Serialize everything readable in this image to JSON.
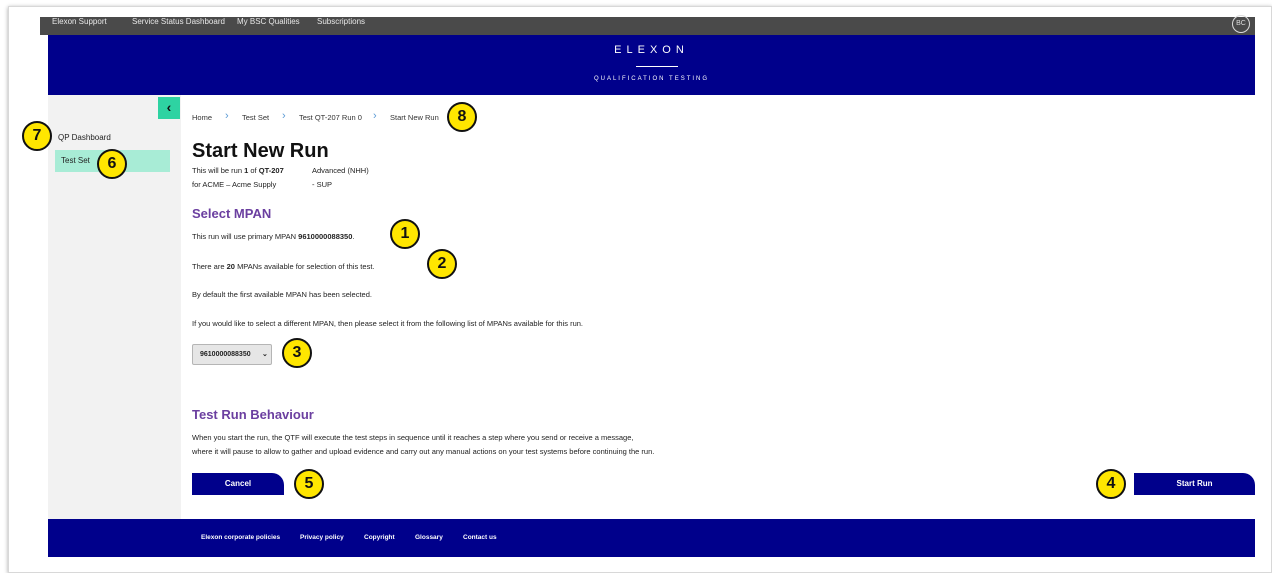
{
  "topbar": {
    "links": [
      "Elexon Support",
      "Service Status Dashboard",
      "My BSC Qualities",
      "Subscriptions"
    ],
    "user_initials": "BC"
  },
  "header": {
    "logo": "ELEXON",
    "subtitle": "QUALIFICATION TESTING"
  },
  "sidebar": {
    "collapse_icon": "‹",
    "items": [
      {
        "label": "QP Dashboard"
      },
      {
        "label": "Test Set"
      }
    ]
  },
  "breadcrumb": [
    "Home",
    "Test Set",
    "Test QT-207 Run 0",
    "Start New Run"
  ],
  "page": {
    "title": "Start New Run",
    "run_line_prefix": "This will be run",
    "run_number": "1",
    "run_of": "of",
    "test_id": "QT-207",
    "test_desc": "Advanced (NHH)",
    "for_line": "for ACME – Acme Supply",
    "role": "- SUP"
  },
  "select_mpan": {
    "heading": "Select MPAN",
    "primary_prefix": "This run will use primary MPAN",
    "primary_mpan": "9610000088350",
    "available_prefix": "There are",
    "available_count": "20",
    "available_suffix": "MPANs available for selection of this test.",
    "default_text": "By default the first available MPAN has been selected.",
    "instructions": "If you would like to select a different MPAN, then please select it from the following list of MPANs available for this run.",
    "selected_value": "9610000088350"
  },
  "behaviour": {
    "heading": "Test Run Behaviour",
    "line1": "When you start the run, the QTF will execute the test steps in sequence until it reaches a step where you send or receive a message,",
    "line2": "where it will pause to allow to gather and upload evidence and carry out any manual actions on your test systems before continuing the run."
  },
  "buttons": {
    "cancel": "Cancel",
    "start": "Start Run"
  },
  "footer": {
    "links": [
      "Elexon corporate policies",
      "Privacy policy",
      "Copyright",
      "Glossary",
      "Contact us"
    ]
  },
  "markers": [
    "1",
    "2",
    "3",
    "4",
    "5",
    "6",
    "7",
    "8"
  ],
  "colors": {
    "brand_navy": "#00008b",
    "accent_green": "#2ed3a2",
    "active_nav": "#a8ecd6",
    "heading_purple": "#6b3fa0",
    "marker_yellow": "#ffe600"
  }
}
